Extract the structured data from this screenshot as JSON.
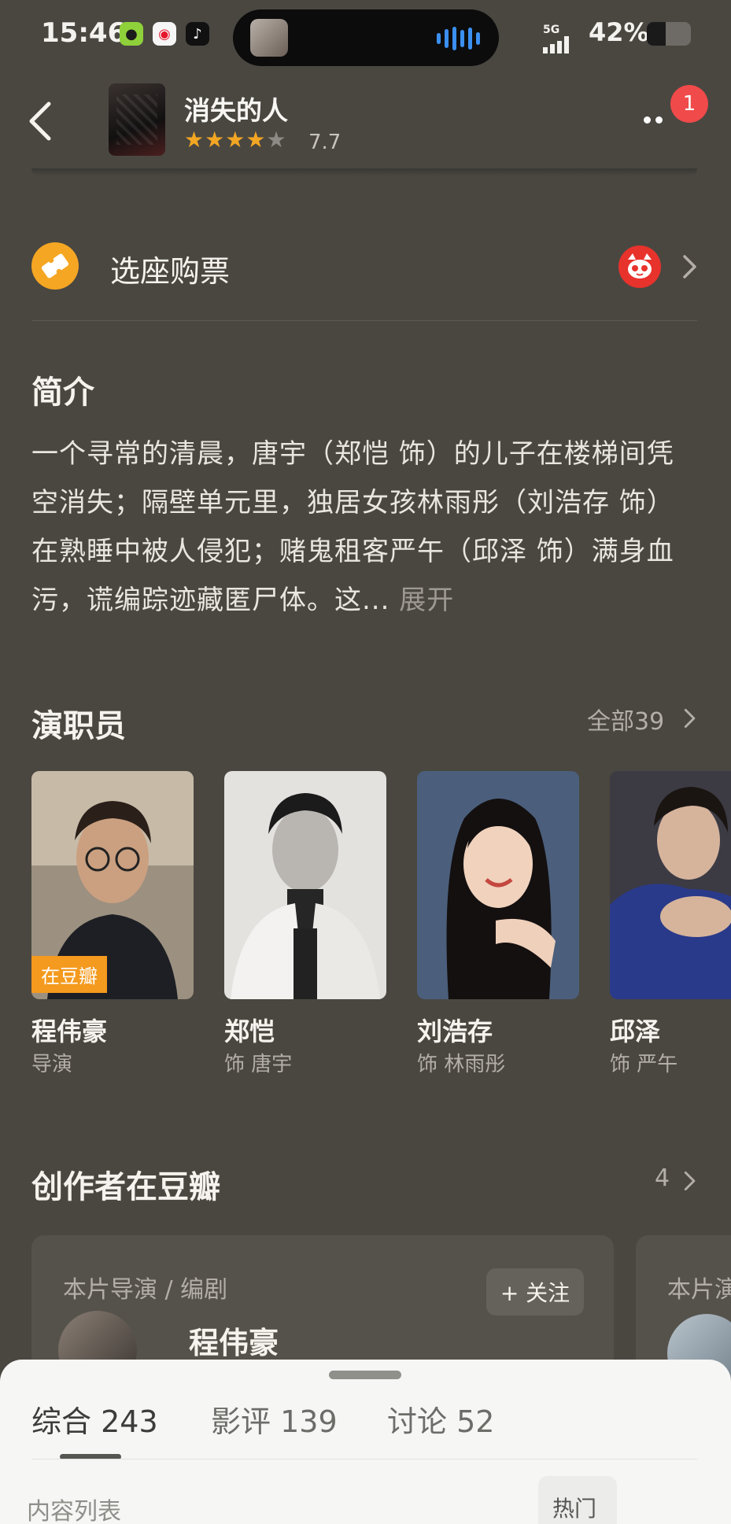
{
  "status_bar": {
    "time": "15:46",
    "network": "5G",
    "battery_percent": "42%",
    "battery_level": 0.42
  },
  "header": {
    "title": "消失的人",
    "rating": "7.7",
    "stars_filled": 4,
    "notification_count": "1"
  },
  "ticket": {
    "label": "选座购票"
  },
  "synopsis": {
    "title": "简介",
    "text": "一个寻常的清晨，唐宇（郑恺 饰）的儿子在楼梯间凭空消失；隔壁单元里，独居女孩林雨彤（刘浩存 饰）在熟睡中被人侵犯；赌鬼租客严午（邱泽 饰）满身血污，谎编踪迹藏匿尸体。这... ",
    "expand": "展开"
  },
  "cast": {
    "title": "演职员",
    "see_all": "全部39",
    "members": [
      {
        "name": "程伟豪",
        "role": "导演",
        "badge": "在豆瓣"
      },
      {
        "name": "郑恺",
        "role": "饰 唐宇"
      },
      {
        "name": "刘浩存",
        "role": "饰 林雨彤"
      },
      {
        "name": "邱泽",
        "role": "饰 严午"
      }
    ]
  },
  "creators": {
    "title": "创作者在豆瓣",
    "count": "4",
    "cards": [
      {
        "role": "本片导演 / 编剧",
        "name": "程伟豪",
        "follow": "+ 关注"
      },
      {
        "role": "本片演"
      }
    ]
  },
  "bottom_sheet": {
    "tabs": [
      {
        "label": "综合",
        "count": "243"
      },
      {
        "label": "影评",
        "count": "139"
      },
      {
        "label": "讨论",
        "count": "52"
      }
    ],
    "list_label": "内容列表",
    "sort_button": "热门"
  },
  "colors": {
    "background": "#4a4741",
    "star": "#f3a623",
    "badge_red": "#f04a4a",
    "douban_orange": "#f49a1e"
  }
}
